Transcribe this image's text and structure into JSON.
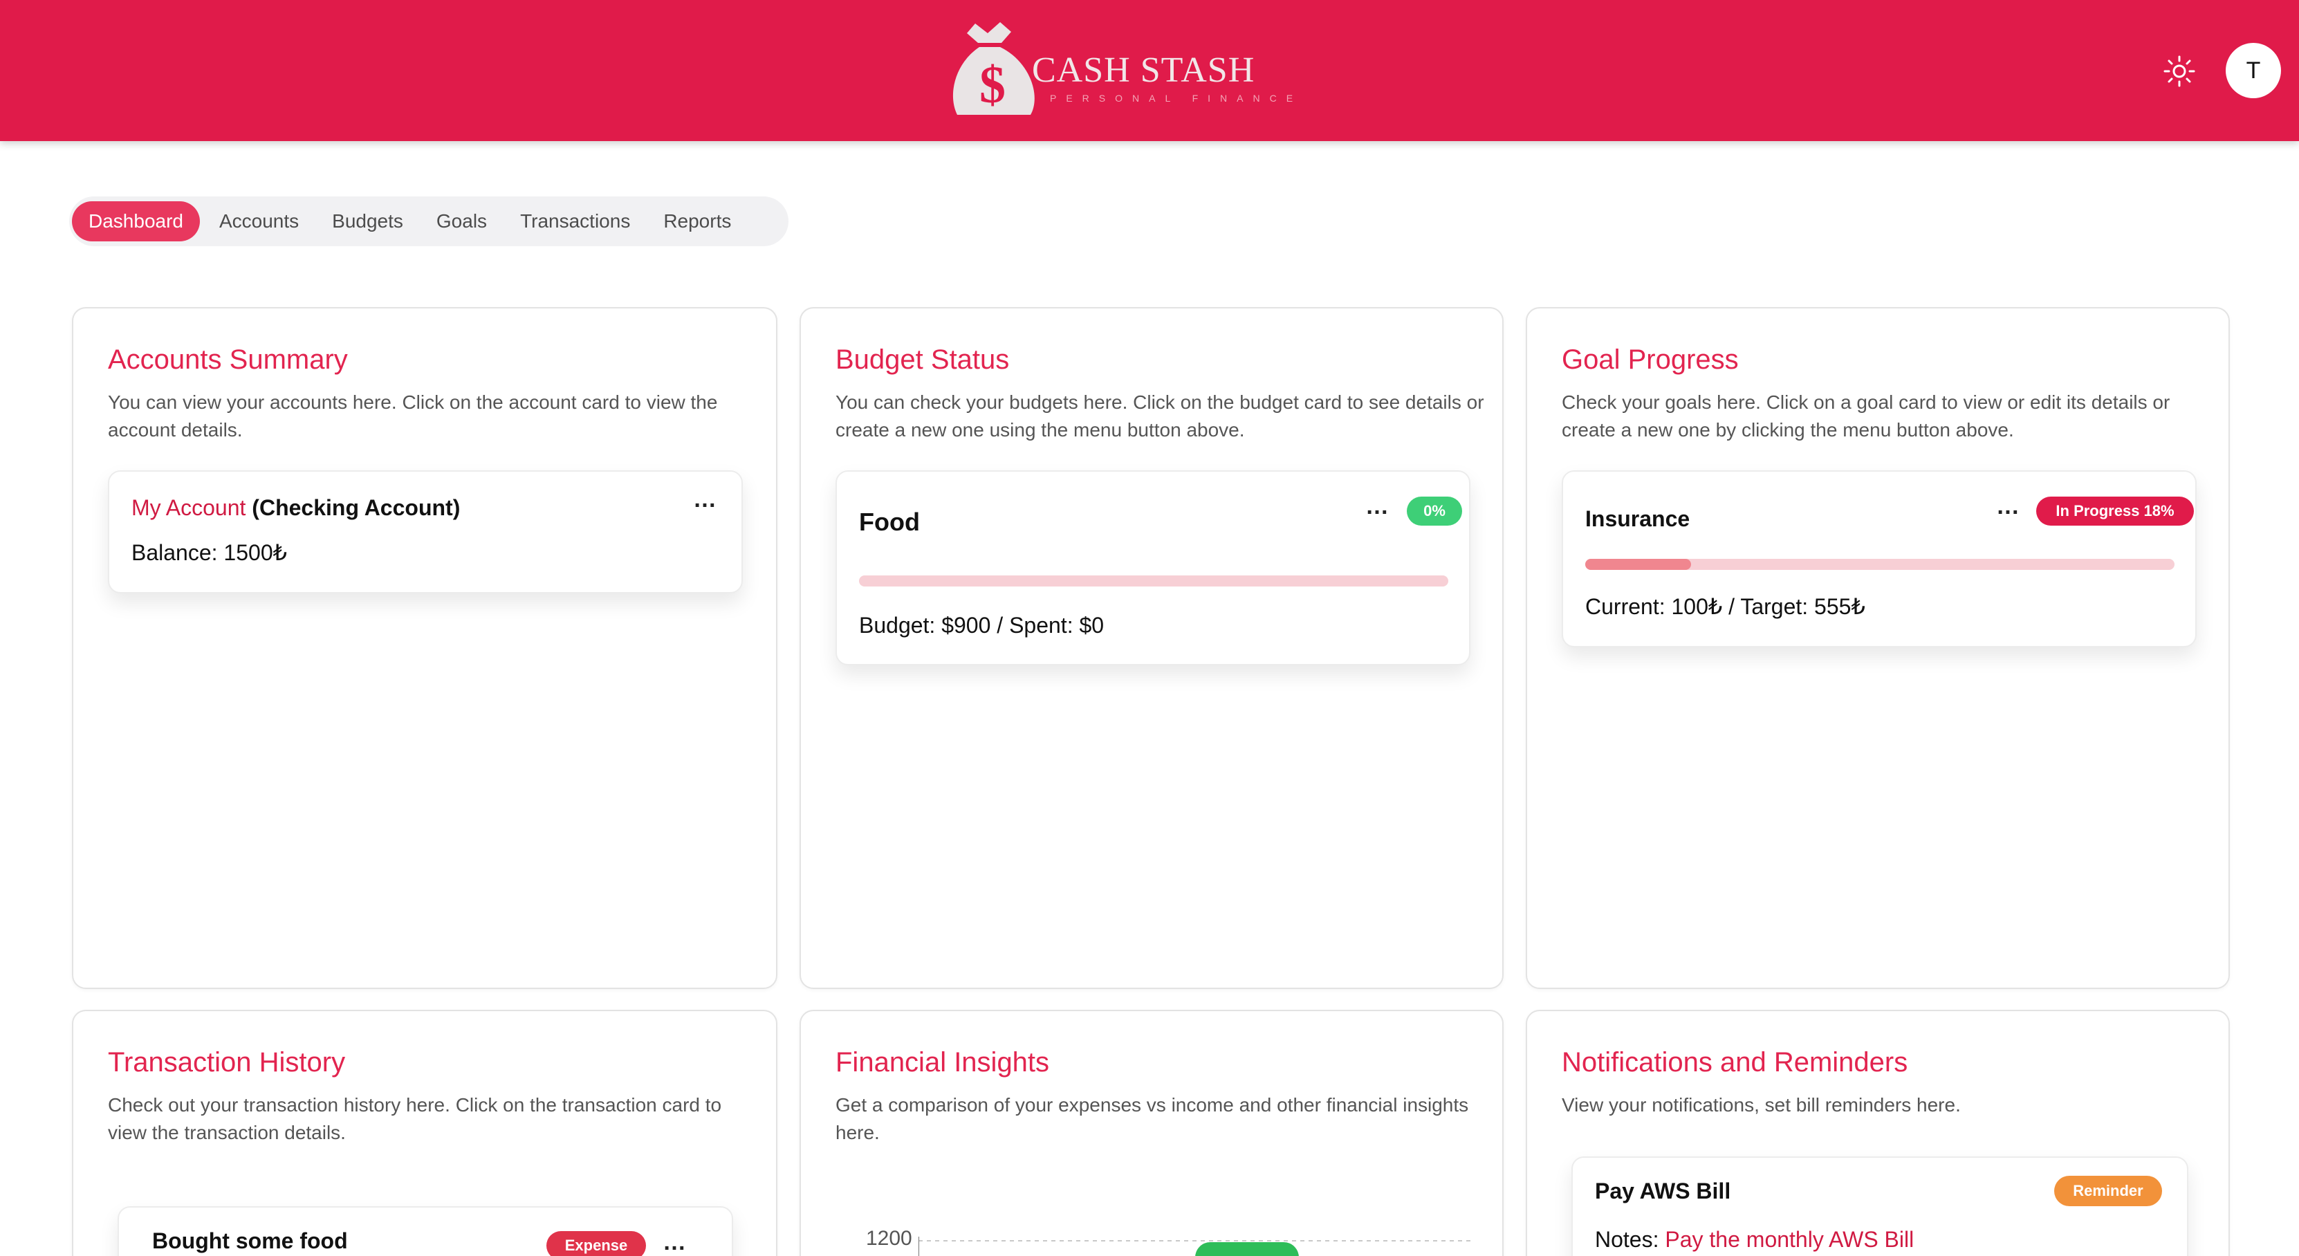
{
  "header": {
    "brand_name": "CASH STASH",
    "brand_tagline": "PERSONAL FINANCE",
    "logo_icon": "money-bag-icon",
    "theme_icon": "sun-icon",
    "avatar_initial": "T",
    "colors": {
      "header_bg": "#e01b4a",
      "accent": "#e2244f"
    }
  },
  "nav": {
    "tabs": [
      {
        "label": "Dashboard",
        "active": true
      },
      {
        "label": "Accounts"
      },
      {
        "label": "Budgets"
      },
      {
        "label": "Goals"
      },
      {
        "label": "Transactions"
      },
      {
        "label": "Reports"
      }
    ]
  },
  "accounts_summary": {
    "title": "Accounts Summary",
    "description": "You can view your accounts here. Click on the account card to view the account details.",
    "account": {
      "name": "My Account",
      "type": "(Checking Account)",
      "balance": "Balance: 1500₺",
      "menu": "…"
    }
  },
  "budget_status": {
    "title": "Budget Status",
    "description": "You can check your budgets here. Click on the budget card to see details or create a new one using the menu button above.",
    "budget": {
      "name": "Food",
      "badge": "0%",
      "progress": 0,
      "details": "Budget: $900 / Spent: $0",
      "menu": "…"
    }
  },
  "goal_progress": {
    "title": "Goal Progress",
    "description": "Check your goals here. Click on a goal card to view or edit its details or create a new one by clicking the menu button above.",
    "goal": {
      "name": "Insurance",
      "badge": "In Progress 18%",
      "progress": 0.18,
      "details": "Current: 100₺ / Target: 555₺",
      "menu": "…"
    }
  },
  "transaction_history": {
    "title": "Transaction History",
    "description": "Check out your transaction history here. Click on the transaction card to view the transaction details.",
    "transaction": {
      "name": "Bought some food",
      "badge": "Expense",
      "menu": "…"
    }
  },
  "financial_insights": {
    "title": "Financial Insights",
    "description": "Get a comparison of your expenses vs income and other financial insights here.",
    "chart_tick": "1200"
  },
  "notifications": {
    "title": "Notifications and Reminders",
    "description": "View your notifications, set bill reminders here.",
    "reminder": {
      "name": "Pay AWS Bill",
      "badge": "Reminder",
      "notes_label": "Notes:",
      "notes_value": "Pay the monthly AWS Bill"
    }
  }
}
